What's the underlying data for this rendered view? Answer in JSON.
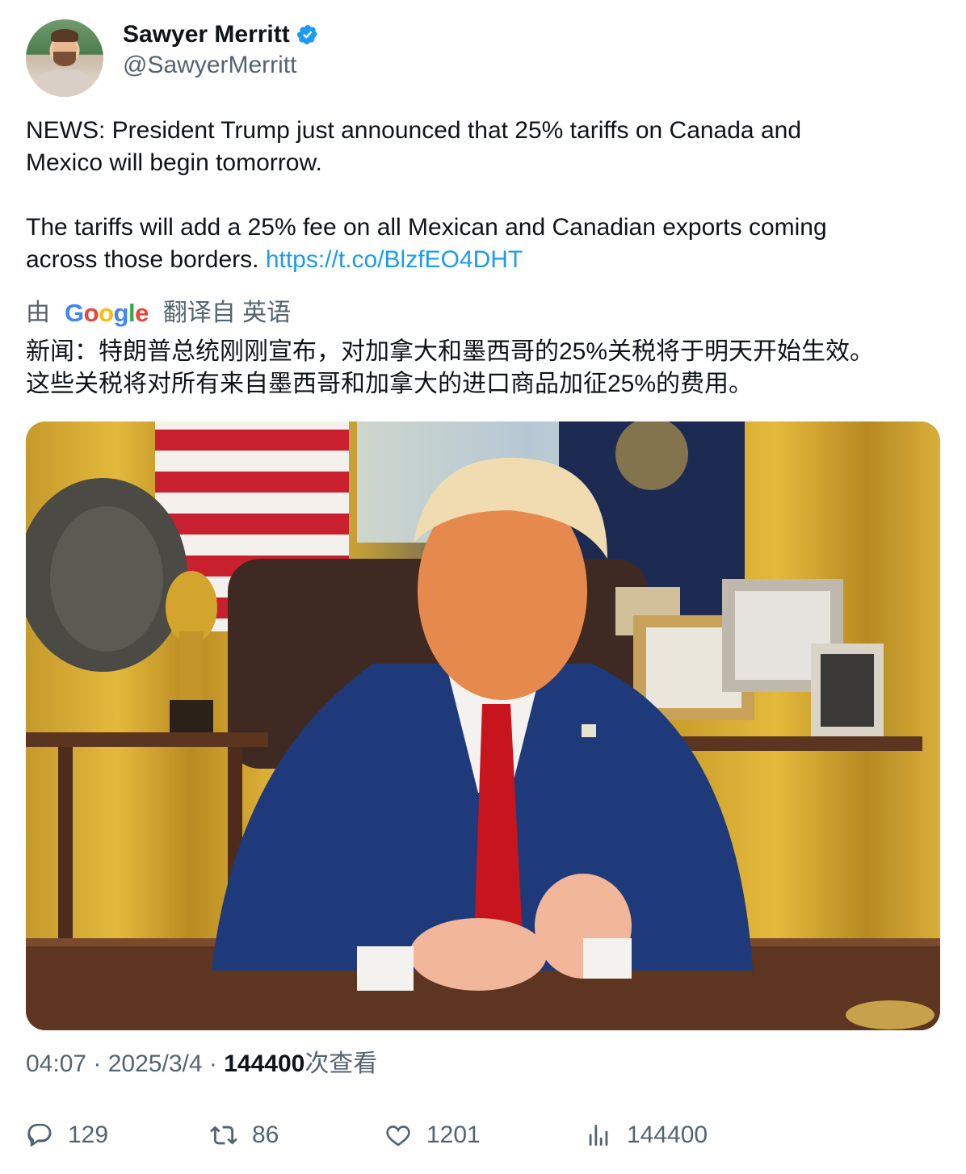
{
  "author": {
    "name": "Sawyer Merritt",
    "handle": "@SawyerMerritt",
    "verified_color": "#1d9bf0"
  },
  "tweet": {
    "text_part1": "NEWS: President Trump just announced that 25% tariffs on Canada and\nMexico will begin tomorrow.\n\nThe tariffs will add a 25% fee on all Mexican and Canadian exports coming\nacross those borders. ",
    "link": "https://t.co/BlzfEO4DHT"
  },
  "translation": {
    "prefix": "由",
    "provider": "Google",
    "label": "翻译自 英语",
    "text": "新闻：特朗普总统刚刚宣布，对加拿大和墨西哥的25%关税将于明天开始生效。\n这些关税将对所有来自墨西哥和加拿大的进口商品加征25%的费用。"
  },
  "meta": {
    "time": "04:07",
    "sep1": " · ",
    "date": "2025/3/4",
    "sep2": " · ",
    "views": "144400",
    "views_suffix": "次查看"
  },
  "actions": {
    "replies": "129",
    "retweets": "86",
    "likes": "1201",
    "views": "144400"
  },
  "colors": {
    "text": "#0f1419",
    "secondary": "#536471",
    "link": "#1d9bf0"
  },
  "icons": [
    "verified-badge-icon",
    "reply-icon",
    "retweet-icon",
    "like-icon",
    "views-icon"
  ]
}
